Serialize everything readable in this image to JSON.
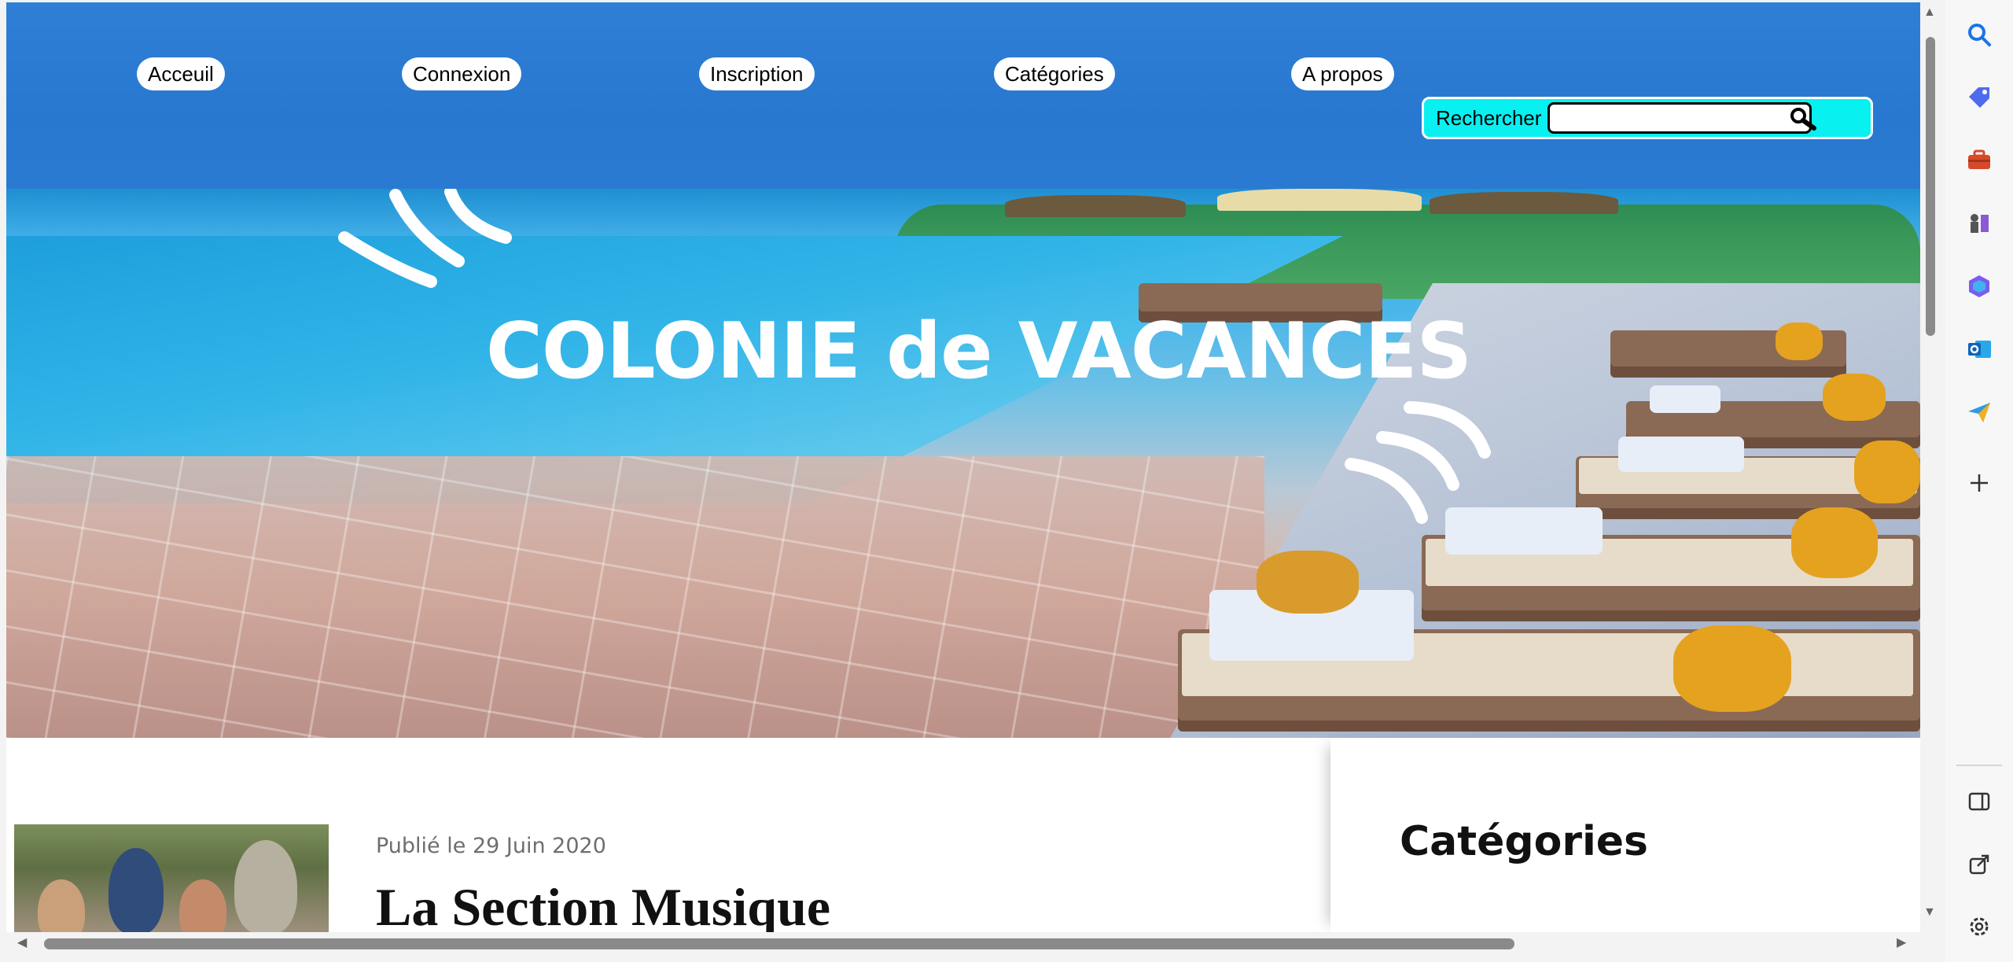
{
  "nav": {
    "items": [
      {
        "label": "Acceuil"
      },
      {
        "label": "Connexion"
      },
      {
        "label": "Inscription"
      },
      {
        "label": "Catégories"
      },
      {
        "label": "A propos"
      }
    ]
  },
  "search": {
    "label": "Rechercher",
    "value": "",
    "placeholder": ""
  },
  "hero": {
    "title": "COLONIE de VACANCES"
  },
  "post": {
    "date": "Publié le 29 Juin 2020",
    "title": "La Section Musique"
  },
  "sidebar": {
    "title": "Catégories"
  },
  "colors": {
    "header_blue": "#2978d0",
    "search_cyan": "#08f0f0"
  },
  "browser_sidebar": {
    "icons": [
      "search-icon",
      "tag-icon",
      "toolbox-icon",
      "chess-icon",
      "copilot-icon",
      "outlook-icon",
      "send-icon",
      "add-icon",
      "split-view-icon",
      "open-external-icon",
      "settings-icon"
    ]
  }
}
